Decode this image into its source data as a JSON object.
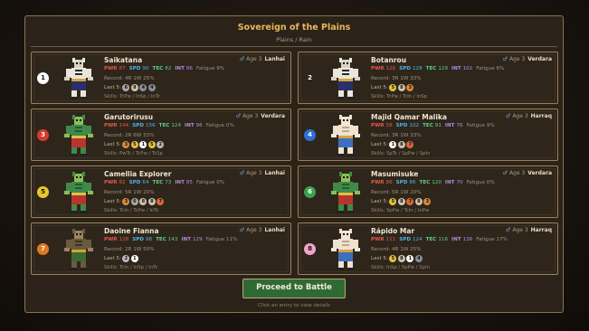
{
  "header": {
    "title": "Sovereign of the Plains",
    "subtitle": "Plains / Rain"
  },
  "colors": {
    "gold": "#e9b75b",
    "pwr": "#e8574a",
    "spd": "#4fb3e8",
    "tec": "#5bd08a",
    "int": "#b28ae6",
    "button": "#2f6a35"
  },
  "labels": {
    "age_prefix": "Age",
    "record_prefix": "Record:",
    "last5_prefix": "Last 5:",
    "skills_prefix": "Skills:",
    "fatigue_prefix": "Fatigue",
    "gender_symbol": "♂"
  },
  "entries": [
    {
      "seed": "1",
      "seed_color": "#ffffff",
      "seed_text": "#111111",
      "name": "Saikatana",
      "age": "3",
      "stable": "Lanhai",
      "pwr": "87",
      "spd": "90",
      "tec": "82",
      "int": "86",
      "fatigue": "9%",
      "record": "4R 1W 25%",
      "last5": [
        "6",
        "8",
        "4",
        "4"
      ],
      "skills": "TcPw / InSp / InTc"
    },
    {
      "seed": "2",
      "seed_color": "#2b2319",
      "seed_text": "#ffffff",
      "name": "Botanrou",
      "age": "3",
      "stable": "Verdara",
      "pwr": "126",
      "spd": "128",
      "tec": "129",
      "int": "102",
      "fatigue": "6%",
      "record": "3R 1W 33%",
      "last5": [
        "5",
        "8",
        "3"
      ],
      "skills": "TcPw / TcIn / InSp"
    },
    {
      "seed": "3",
      "seed_color": "#d63a2f",
      "seed_text": "#ffffff",
      "name": "Garutorirusu",
      "age": "3",
      "stable": "Verdara",
      "pwr": "144",
      "spd": "156",
      "tec": "124",
      "int": "96",
      "fatigue": "0%",
      "record": "2R 6W 33%",
      "last5": [
        "3",
        "5",
        "1",
        "5",
        "2"
      ],
      "skills": "PwTc / TcPw / TcSp"
    },
    {
      "seed": "4",
      "seed_color": "#2e6fd6",
      "seed_text": "#ffffff",
      "name": "Majid Qamar Malika",
      "age": "3",
      "stable": "Harraq",
      "pwr": "58",
      "spd": "102",
      "tec": "91",
      "int": "76",
      "fatigue": "9%",
      "record": "3R 1W 33%",
      "last5": [
        "1",
        "8",
        "7"
      ],
      "skills": "SpTc / SpPw / SpIn"
    },
    {
      "seed": "5",
      "seed_color": "#e6c82a",
      "seed_text": "#111111",
      "name": "Camellia Explorer",
      "age": "3",
      "stable": "Lanhai",
      "pwr": "82",
      "spd": "64",
      "tec": "73",
      "int": "85",
      "fatigue": "0%",
      "record": "5R 1W 20%",
      "last5": [
        "3",
        "6",
        "8",
        "8",
        "7"
      ],
      "skills": "TcIn / TcPw / InTc"
    },
    {
      "seed": "6",
      "seed_color": "#3aa24e",
      "seed_text": "#ffffff",
      "name": "Masumisuke",
      "age": "3",
      "stable": "Verdara",
      "pwr": "86",
      "spd": "86",
      "tec": "120",
      "int": "70",
      "fatigue": "0%",
      "record": "5R 1W 20%",
      "last5": [
        "5",
        "8",
        "7",
        "8",
        "3"
      ],
      "skills": "SpPw / TcIn / InPw"
    },
    {
      "seed": "7",
      "seed_color": "#e07a1f",
      "seed_text": "#ffffff",
      "name": "Daoine Fianna",
      "age": "3",
      "stable": "Lanhai",
      "pwr": "128",
      "spd": "98",
      "tec": "143",
      "int": "129",
      "fatigue": "11%",
      "record": "2R 1W 50%",
      "last5": [
        "2",
        "1"
      ],
      "skills": "TcIn / InSp / InTc"
    },
    {
      "seed": "8",
      "seed_color": "#f0a6c8",
      "seed_text": "#111111",
      "name": "Rápido Mar",
      "age": "3",
      "stable": "Harraq",
      "pwr": "111",
      "spd": "124",
      "tec": "116",
      "int": "136",
      "fatigue": "17%",
      "record": "4R 1W 25%",
      "last5": [
        "5",
        "8",
        "1",
        "4"
      ],
      "skills": "InSp / SpPw / SpIn"
    }
  ],
  "dot_colors": {
    "1": "#ffffff",
    "2": "#b9b9b9",
    "3": "#d98a3a",
    "4": "#8a8f9a",
    "5": "#e6c23a",
    "6": "#a8a8a8",
    "7": "#d86a3c",
    "8": "#cfc4b0"
  },
  "sprites": [
    "tiger",
    "tiger",
    "lizard",
    "rabbit",
    "lizard",
    "lizard",
    "beast",
    "rabbit"
  ],
  "button": {
    "label": "Proceed to Battle"
  },
  "hint": "Click an entry to view details"
}
